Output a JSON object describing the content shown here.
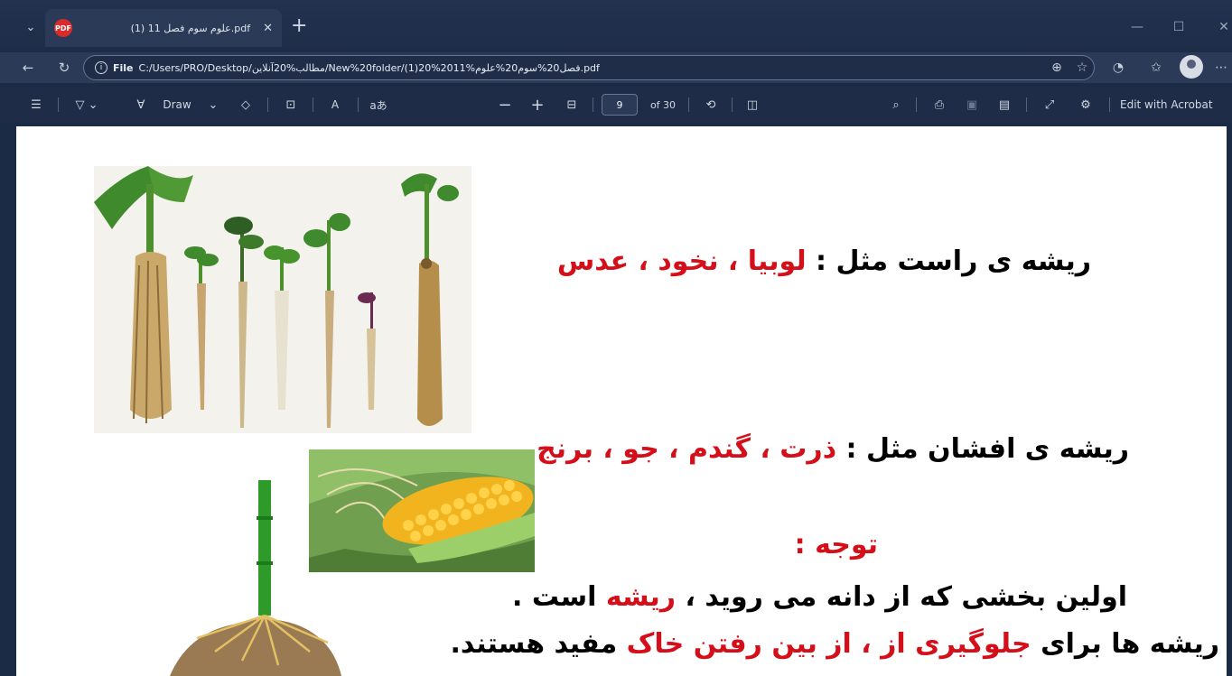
{
  "tab": {
    "title": "علوم سوم فصل 11 (1).pdf"
  },
  "address": {
    "scheme_label": "File",
    "url": "C:/Users/PRO/Desktop/مطالب%20آنلاین/New%20folder/(1)20%2011%فصل20%سوم20%علوم.pdf"
  },
  "toolbar": {
    "draw_label": "Draw",
    "read_aloud_label": "A",
    "translate_label": "aあ",
    "page_current": "9",
    "page_total": "of 30",
    "acrobat_label": "Edit with Acrobat"
  },
  "document": {
    "line1": {
      "prefix": "ریشه ی راست مثل : ",
      "highlight": "لوبیا ، نخود ، عدس"
    },
    "line2": {
      "prefix": "ریشه ی افشان مثل : ",
      "highlight": "ذرت ، گندم ، جو ، برنج"
    },
    "note_heading": "توجه :",
    "note_line1": {
      "part1": "اولین بخشی که از دانه می روید ، ",
      "highlight": "ریشه",
      "part2": " است ."
    },
    "note_line2": {
      "part1": "ریشه ها برای ",
      "highlight1": "جلوگیری از ، از بین رفتن خاک",
      "part2": " مفید هستند."
    }
  },
  "colors": {
    "highlight": "#d40f1a",
    "chrome_bg": "#1e2c47",
    "tab_bg": "#2b3a56"
  }
}
